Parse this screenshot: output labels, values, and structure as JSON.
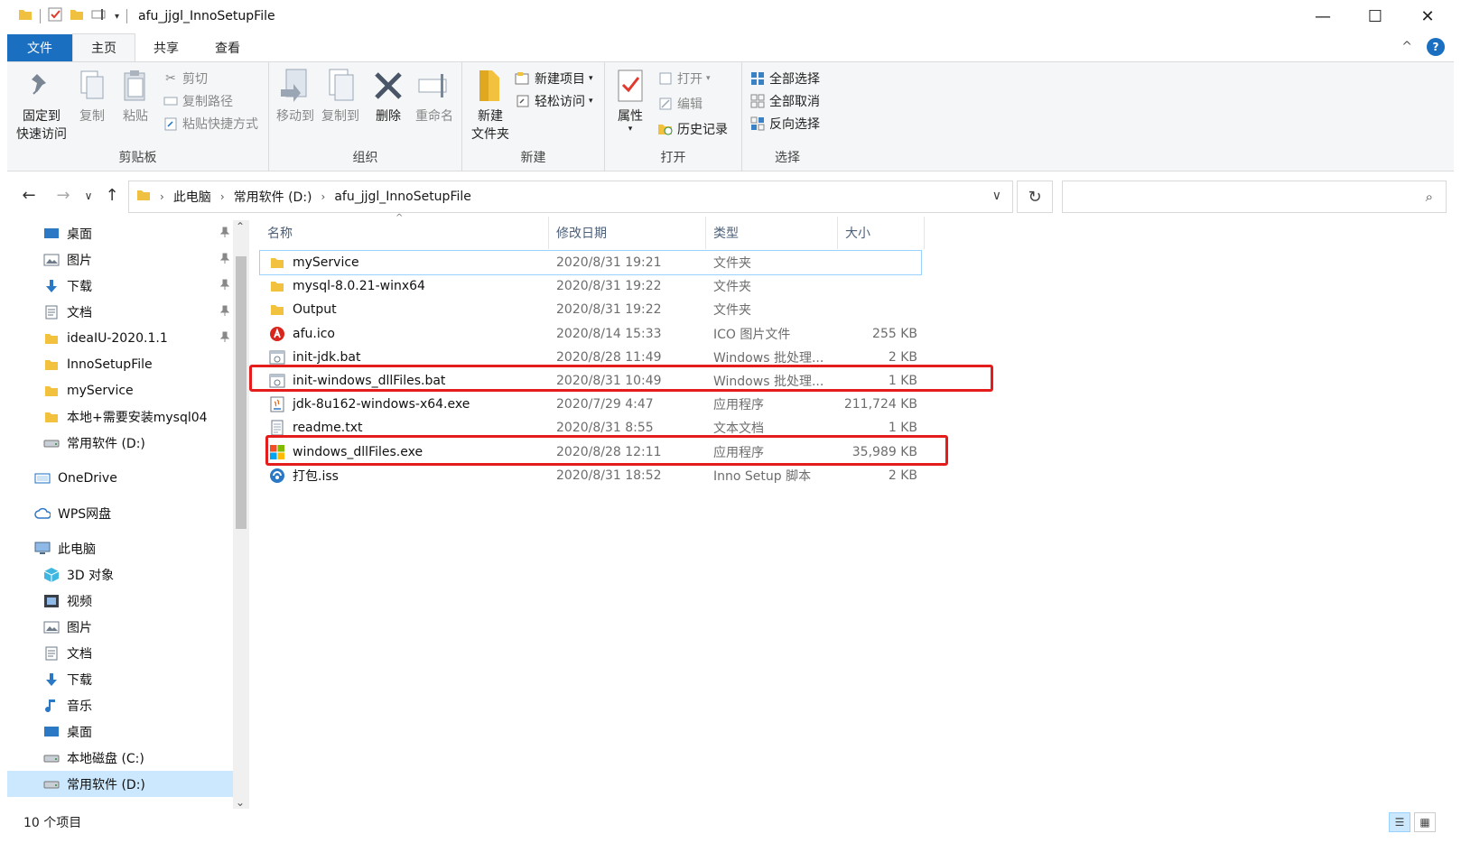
{
  "window": {
    "title": "afu_jjgl_InnoSetupFile",
    "minimize": "—",
    "maximize": "☐",
    "close": "✕"
  },
  "tabs": {
    "file": "文件",
    "home": "主页",
    "share": "共享",
    "view": "查看",
    "collapse": "^",
    "help": "?"
  },
  "ribbon": {
    "clipboard": {
      "label": "剪贴板",
      "pin": "固定到\n快速访问",
      "pin_line1": "固定到",
      "pin_line2": "快速访问",
      "copy": "复制",
      "paste": "粘贴",
      "cut": "剪切",
      "copy_path": "复制路径",
      "paste_shortcut": "粘贴快捷方式"
    },
    "organize": {
      "label": "组织",
      "move_to": "移动到",
      "copy_to": "复制到",
      "delete": "删除",
      "rename": "重命名"
    },
    "new": {
      "label": "新建",
      "new_folder_line1": "新建",
      "new_folder_line2": "文件夹",
      "new_item": "新建项目",
      "easy_access": "轻松访问"
    },
    "open": {
      "label": "打开",
      "properties": "属性",
      "open": "打开",
      "edit": "编辑",
      "history": "历史记录"
    },
    "select": {
      "label": "选择",
      "select_all": "全部选择",
      "select_none": "全部取消",
      "invert": "反向选择"
    }
  },
  "address": {
    "crumbs": [
      "此电脑",
      "常用软件 (D:)",
      "afu_jjgl_InnoSetupFile"
    ],
    "search_placeholder": ""
  },
  "sidebar": {
    "items": [
      {
        "label": "桌面",
        "icon": "desktop-icon",
        "pinned": true
      },
      {
        "label": "图片",
        "icon": "pictures-icon",
        "pinned": true
      },
      {
        "label": "下载",
        "icon": "download-icon",
        "pinned": true
      },
      {
        "label": "文档",
        "icon": "documents-icon",
        "pinned": true
      },
      {
        "label": "ideaIU-2020.1.1",
        "icon": "folder-icon",
        "pinned": true
      },
      {
        "label": "InnoSetupFile",
        "icon": "folder-icon",
        "pinned": false
      },
      {
        "label": "myService",
        "icon": "folder-icon",
        "pinned": false
      },
      {
        "label": "本地+需要安装mysql04",
        "icon": "folder-icon",
        "pinned": false
      },
      {
        "label": "常用软件 (D:)",
        "icon": "drive-icon",
        "pinned": false
      },
      {
        "label": "OneDrive",
        "icon": "onedrive-icon",
        "pinned": false
      },
      {
        "label": "WPS网盘",
        "icon": "cloud-icon",
        "pinned": false
      },
      {
        "label": "此电脑",
        "icon": "computer-icon",
        "pinned": false
      },
      {
        "label": "3D 对象",
        "icon": "3d-objects-icon",
        "pinned": false
      },
      {
        "label": "视频",
        "icon": "videos-icon",
        "pinned": false
      },
      {
        "label": "图片",
        "icon": "pictures-icon",
        "pinned": false
      },
      {
        "label": "文档",
        "icon": "documents-icon",
        "pinned": false
      },
      {
        "label": "下载",
        "icon": "download-icon",
        "pinned": false
      },
      {
        "label": "音乐",
        "icon": "music-icon",
        "pinned": false
      },
      {
        "label": "桌面",
        "icon": "desktop-icon",
        "pinned": false
      },
      {
        "label": "本地磁盘 (C:)",
        "icon": "drive-icon",
        "pinned": false
      },
      {
        "label": "常用软件 (D:)",
        "icon": "drive-icon",
        "pinned": false
      }
    ]
  },
  "list": {
    "columns": [
      "名称",
      "修改日期",
      "类型",
      "大小"
    ],
    "rows": [
      {
        "name": "myService",
        "date": "2020/8/31 19:21",
        "type": "文件夹",
        "size": "",
        "icon": "folder-icon"
      },
      {
        "name": "mysql-8.0.21-winx64",
        "date": "2020/8/31 19:22",
        "type": "文件夹",
        "size": "",
        "icon": "folder-icon"
      },
      {
        "name": "Output",
        "date": "2020/8/31 19:22",
        "type": "文件夹",
        "size": "",
        "icon": "folder-icon"
      },
      {
        "name": "afu.ico",
        "date": "2020/8/14 15:33",
        "type": "ICO 图片文件",
        "size": "255 KB",
        "icon": "ico-file-icon"
      },
      {
        "name": "init-jdk.bat",
        "date": "2020/8/28 11:49",
        "type": "Windows 批处理...",
        "size": "2 KB",
        "icon": "bat-file-icon"
      },
      {
        "name": "init-windows_dllFiles.bat",
        "date": "2020/8/31 10:49",
        "type": "Windows 批处理...",
        "size": "1 KB",
        "icon": "bat-file-icon"
      },
      {
        "name": "jdk-8u162-windows-x64.exe",
        "date": "2020/7/29 4:47",
        "type": "应用程序",
        "size": "211,724 KB",
        "icon": "java-installer-icon"
      },
      {
        "name": "readme.txt",
        "date": "2020/8/31 8:55",
        "type": "文本文档",
        "size": "1 KB",
        "icon": "text-file-icon"
      },
      {
        "name": "windows_dllFiles.exe",
        "date": "2020/8/28 12:11",
        "type": "应用程序",
        "size": "35,989 KB",
        "icon": "windows-app-icon"
      },
      {
        "name": "打包.iss",
        "date": "2020/8/31 18:52",
        "type": "Inno Setup 脚本",
        "size": "2 KB",
        "icon": "iss-file-icon"
      }
    ]
  },
  "status": {
    "count": "10 个项目"
  },
  "colors": {
    "accent": "#1a6fc0",
    "highlight": "#e41c1c",
    "selection": "#cce8ff"
  }
}
